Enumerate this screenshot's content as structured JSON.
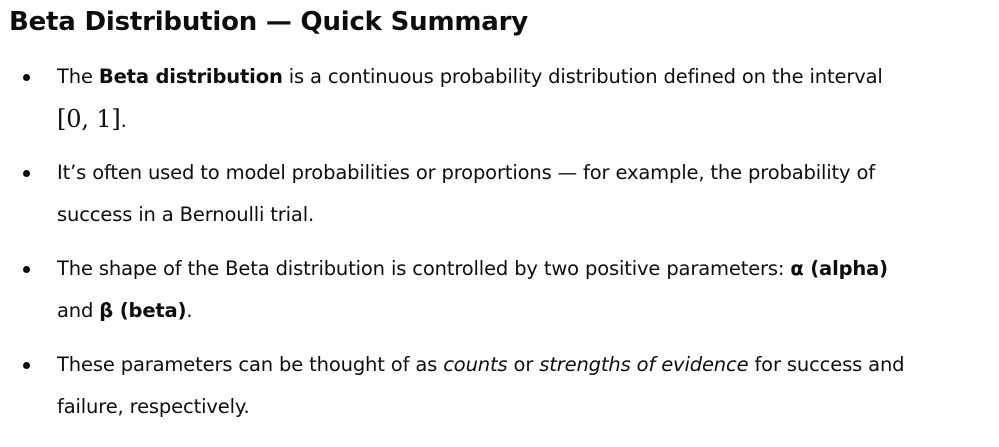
{
  "heading": "Beta Distribution — Quick Summary",
  "bullets": [
    {
      "line1_a": "The ",
      "line1_b": "Beta distribution",
      "line1_c": " is a continuous probability distribution defined on the interval",
      "line2_math": "[0, 1]",
      "line2_end": "."
    },
    {
      "line1": "It’s often used to model probabilities or proportions — for example, the probability of",
      "line2": "success in a Bernoulli trial."
    },
    {
      "line1_a": "The shape of the Beta distribution is controlled by two positive parameters: ",
      "line1_b": "α (alpha)",
      "line2_a": "and ",
      "line2_b": "β (beta)",
      "line2_c": "."
    },
    {
      "line1_a": "These parameters can be thought of as ",
      "line1_b": "counts",
      "line1_c": " or ",
      "line1_d": "strengths of evidence",
      "line1_e": " for success and",
      "line2": "failure, respectively."
    }
  ]
}
